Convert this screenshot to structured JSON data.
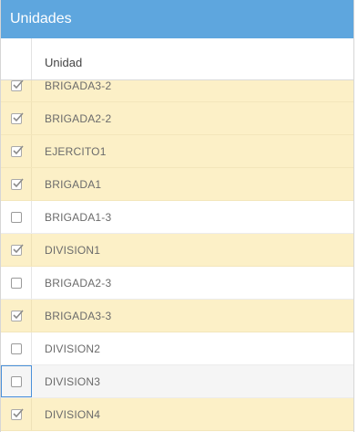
{
  "panel": {
    "title": "Unidades",
    "column_header": "Unidad"
  },
  "rows": [
    {
      "label": "BRIGADA3-2",
      "checked": true
    },
    {
      "label": "BRIGADA2-2",
      "checked": true
    },
    {
      "label": "EJERCITO1",
      "checked": true
    },
    {
      "label": "BRIGADA1",
      "checked": true
    },
    {
      "label": "BRIGADA1-3",
      "checked": false
    },
    {
      "label": "DIVISION1",
      "checked": true
    },
    {
      "label": "BRIGADA2-3",
      "checked": false
    },
    {
      "label": "BRIGADA3-3",
      "checked": true
    },
    {
      "label": "DIVISION2",
      "checked": false
    },
    {
      "label": "DIVISION3",
      "checked": false
    },
    {
      "label": "DIVISION4",
      "checked": true
    }
  ],
  "colors": {
    "header_bg": "#5ea6de",
    "selected_row_bg": "#fcf0c7",
    "checkmark": "#8a8a8a"
  }
}
